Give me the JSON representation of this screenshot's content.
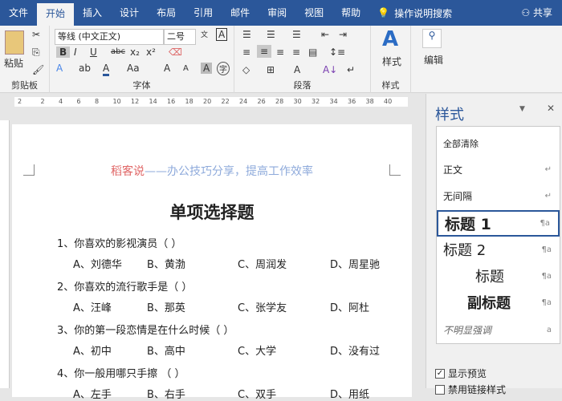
{
  "tabs": [
    "文件",
    "开始",
    "插入",
    "设计",
    "布局",
    "引用",
    "邮件",
    "审阅",
    "视图",
    "帮助"
  ],
  "active_tab": "开始",
  "tell_me": "操作说明搜索",
  "share": "共享",
  "ribbon": {
    "clipboard": {
      "paste": "粘贴",
      "label": "剪贴板"
    },
    "font": {
      "name": "等线 (中文正文)",
      "size": "二号",
      "label": "字体",
      "bold": "B",
      "italic": "I",
      "underline": "U",
      "strike": "abc",
      "sub": "x₂",
      "sup": "x²",
      "aa": "Aa",
      "grow": "A",
      "shrink": "A"
    },
    "paragraph": {
      "label": "段落"
    },
    "styles": {
      "button": "样式",
      "label": "样式"
    },
    "editing": {
      "button": "编辑"
    }
  },
  "ruler": [
    "2",
    "2",
    "4",
    "6",
    "8",
    "10",
    "12",
    "14",
    "16",
    "18",
    "20",
    "22",
    "24",
    "26",
    "28",
    "30",
    "32",
    "34",
    "36",
    "38",
    "40"
  ],
  "document": {
    "header_red": "稻客说",
    "header_blue": "——办公技巧分享，提高工作效率",
    "title": "单项选择题",
    "questions": [
      {
        "q": "1、你喜欢的影视演员（          ）",
        "options": [
          "A、刘德华",
          "B、黄渤",
          "C、周润发",
          "D、周星驰"
        ]
      },
      {
        "q": "2、你喜欢的流行歌手是（          ）",
        "options": [
          "A、汪峰",
          "B、那英",
          "C、张学友",
          "D、阿杜"
        ]
      },
      {
        "q": "3、你的第一段恋情是在什么时候（          ）",
        "options": [
          "A、初中",
          "B、高中",
          "C、大学",
          "D、没有过"
        ]
      },
      {
        "q": "4、你一般用哪只手擦          （          ）",
        "options": [
          "A、左手",
          "B、右手",
          "C、双手",
          "D、用纸"
        ]
      }
    ]
  },
  "styles_pane": {
    "title": "样式",
    "items": [
      {
        "label": "全部清除",
        "mark": ""
      },
      {
        "label": "正文",
        "mark": "↵"
      },
      {
        "label": "无间隔",
        "mark": "↵"
      },
      {
        "label": "标题 1",
        "mark": "¶a"
      },
      {
        "label": "标题 2",
        "mark": "¶a"
      },
      {
        "label": "标题",
        "mark": "¶a"
      },
      {
        "label": "副标题",
        "mark": "¶a"
      },
      {
        "label": "不明显强调",
        "mark": "a"
      }
    ],
    "show_preview": "显示预览",
    "disable_linked": "禁用链接样式"
  }
}
